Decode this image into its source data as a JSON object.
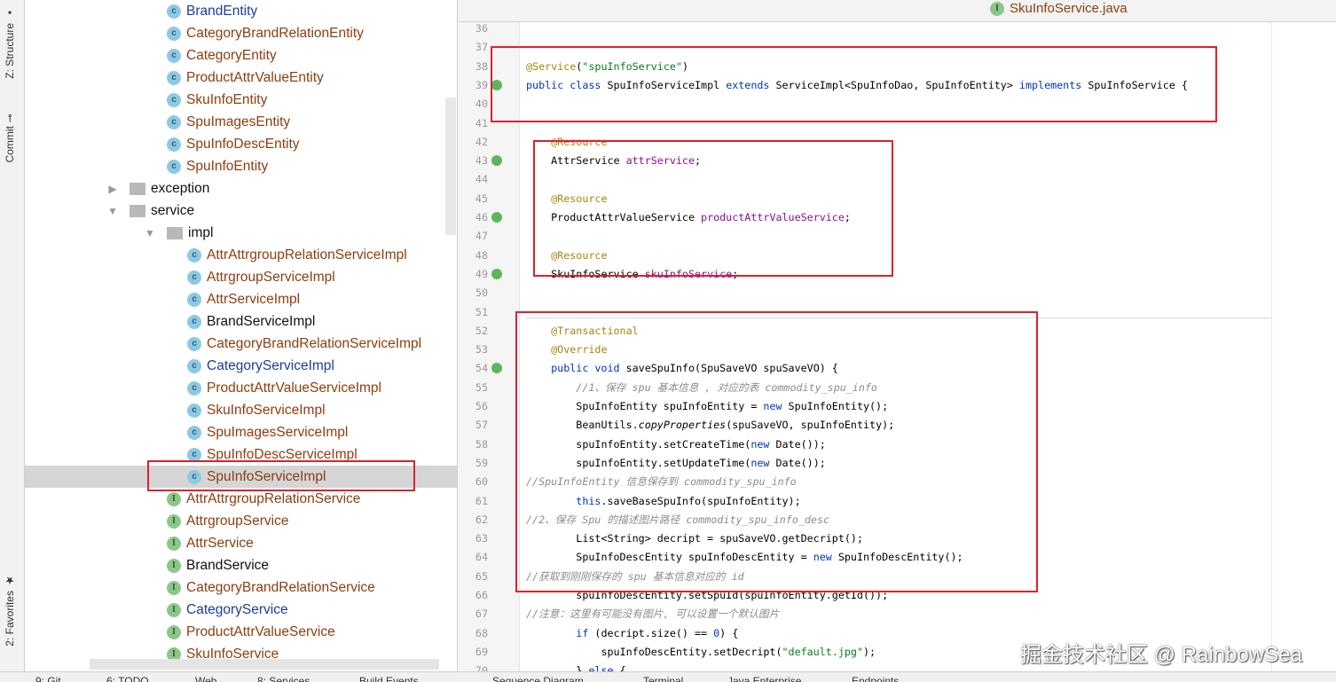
{
  "toolstrip": {
    "structure": "Z: Structure",
    "commit": "Commit",
    "favorites": "2: Favorites"
  },
  "tree": [
    {
      "label": "BrandEntity",
      "kind": "class",
      "color": "blue",
      "indent": 3
    },
    {
      "label": "CategoryBrandRelationEntity",
      "kind": "class",
      "color": "brown",
      "indent": 3
    },
    {
      "label": "CategoryEntity",
      "kind": "class",
      "color": "brown",
      "indent": 3
    },
    {
      "label": "ProductAttrValueEntity",
      "kind": "class",
      "color": "brown",
      "indent": 3
    },
    {
      "label": "SkuInfoEntity",
      "kind": "class",
      "color": "brown",
      "indent": 3
    },
    {
      "label": "SpuImagesEntity",
      "kind": "class",
      "color": "brown",
      "indent": 3
    },
    {
      "label": "SpuInfoDescEntity",
      "kind": "class",
      "color": "brown",
      "indent": 3
    },
    {
      "label": "SpuInfoEntity",
      "kind": "class",
      "color": "brown",
      "indent": 3
    },
    {
      "label": "exception",
      "kind": "folder",
      "expanded": false,
      "color": "black",
      "indent": 2
    },
    {
      "label": "service",
      "kind": "folder",
      "expanded": true,
      "color": "black",
      "indent": 2
    },
    {
      "label": "impl",
      "kind": "folder",
      "expanded": true,
      "color": "black",
      "indent": 3
    },
    {
      "label": "AttrAttrgroupRelationServiceImpl",
      "kind": "class",
      "color": "brown",
      "indent": 4
    },
    {
      "label": "AttrgroupServiceImpl",
      "kind": "class",
      "color": "brown",
      "indent": 4
    },
    {
      "label": "AttrServiceImpl",
      "kind": "class",
      "color": "brown",
      "indent": 4
    },
    {
      "label": "BrandServiceImpl",
      "kind": "class",
      "color": "black",
      "indent": 4
    },
    {
      "label": "CategoryBrandRelationServiceImpl",
      "kind": "class",
      "color": "brown",
      "indent": 4
    },
    {
      "label": "CategoryServiceImpl",
      "kind": "class",
      "color": "blue",
      "indent": 4
    },
    {
      "label": "ProductAttrValueServiceImpl",
      "kind": "class",
      "color": "brown",
      "indent": 4
    },
    {
      "label": "SkuInfoServiceImpl",
      "kind": "class",
      "color": "brown",
      "indent": 4
    },
    {
      "label": "SpuImagesServiceImpl",
      "kind": "class",
      "color": "brown",
      "indent": 4
    },
    {
      "label": "SpuInfoDescServiceImpl",
      "kind": "class",
      "color": "brown",
      "indent": 4
    },
    {
      "label": "SpuInfoServiceImpl",
      "kind": "class",
      "color": "brown",
      "indent": 4,
      "selected": true
    },
    {
      "label": "AttrAttrgroupRelationService",
      "kind": "interface",
      "color": "brown",
      "indent": 3
    },
    {
      "label": "AttrgroupService",
      "kind": "interface",
      "color": "brown",
      "indent": 3
    },
    {
      "label": "AttrService",
      "kind": "interface",
      "color": "brown",
      "indent": 3
    },
    {
      "label": "BrandService",
      "kind": "interface",
      "color": "black",
      "indent": 3
    },
    {
      "label": "CategoryBrandRelationService",
      "kind": "interface",
      "color": "brown",
      "indent": 3
    },
    {
      "label": "CategoryService",
      "kind": "interface",
      "color": "blue",
      "indent": 3
    },
    {
      "label": "ProductAttrValueService",
      "kind": "interface",
      "color": "brown",
      "indent": 3
    },
    {
      "label": "SkuInfoService",
      "kind": "interface",
      "color": "brown",
      "indent": 3
    }
  ],
  "editor": {
    "tab": "SkuInfoService.java",
    "lines": [
      {
        "n": "36",
        "s": []
      },
      {
        "n": "37",
        "s": []
      },
      {
        "n": "38",
        "s": [
          [
            "@Service",
            "a"
          ],
          [
            "(",
            ""
          ],
          [
            "\"spuInfoService\"",
            "s"
          ],
          [
            ")",
            ""
          ]
        ]
      },
      {
        "n": "39",
        "g": true,
        "s": [
          [
            "public class ",
            "k"
          ],
          [
            "SpuInfoServiceImpl ",
            ""
          ],
          [
            "extends ",
            "k"
          ],
          [
            "ServiceImpl<SpuInfoDao, SpuInfoEntity> ",
            ""
          ],
          [
            "implements ",
            "k"
          ],
          [
            "SpuInfoService {",
            ""
          ]
        ]
      },
      {
        "n": "40",
        "s": []
      },
      {
        "n": "41",
        "s": []
      },
      {
        "n": "42",
        "s": [
          [
            "    @Resource",
            "a"
          ]
        ]
      },
      {
        "n": "43",
        "g": true,
        "s": [
          [
            "    AttrService ",
            ""
          ],
          [
            "attrService",
            "f"
          ],
          [
            ";",
            ""
          ]
        ]
      },
      {
        "n": "44",
        "s": []
      },
      {
        "n": "45",
        "s": [
          [
            "    @Resource",
            "a"
          ]
        ]
      },
      {
        "n": "46",
        "g": true,
        "s": [
          [
            "    ProductAttrValueService ",
            ""
          ],
          [
            "productAttrValueService",
            "f"
          ],
          [
            ";",
            ""
          ]
        ]
      },
      {
        "n": "47",
        "s": []
      },
      {
        "n": "48",
        "s": [
          [
            "    @Resource",
            "a"
          ]
        ]
      },
      {
        "n": "49",
        "g": true,
        "s": [
          [
            "    SkuInfoService ",
            ""
          ],
          [
            "skuInfoService",
            "f"
          ],
          [
            ";",
            ""
          ]
        ]
      },
      {
        "n": "50",
        "s": []
      },
      {
        "n": "51",
        "s": []
      },
      {
        "n": "52",
        "s": [
          [
            "    @Transactional",
            "a"
          ]
        ]
      },
      {
        "n": "53",
        "s": [
          [
            "    @Override",
            "a"
          ]
        ]
      },
      {
        "n": "54",
        "g": true,
        "s": [
          [
            "    public void ",
            "k"
          ],
          [
            "saveSpuInfo(SpuSaveVO spuSaveVO) {",
            ""
          ]
        ]
      },
      {
        "n": "55",
        "s": [
          [
            "        //1、保存 spu 基本信息 , 对应的表 commodity_spu_info",
            "cm"
          ]
        ]
      },
      {
        "n": "56",
        "s": [
          [
            "        SpuInfoEntity spuInfoEntity = ",
            ""
          ],
          [
            "new ",
            "k"
          ],
          [
            "SpuInfoEntity();",
            ""
          ]
        ]
      },
      {
        "n": "57",
        "s": [
          [
            "        BeanUtils.",
            ""
          ],
          [
            "copyProperties",
            "it"
          ],
          [
            "(spuSaveVO, spuInfoEntity);",
            ""
          ]
        ]
      },
      {
        "n": "58",
        "s": [
          [
            "        spuInfoEntity.setCreateTime(",
            ""
          ],
          [
            "new ",
            "k"
          ],
          [
            "Date());",
            ""
          ]
        ]
      },
      {
        "n": "59",
        "s": [
          [
            "        spuInfoEntity.setUpdateTime(",
            ""
          ],
          [
            "new ",
            "k"
          ],
          [
            "Date());",
            ""
          ]
        ]
      },
      {
        "n": "60",
        "s": [
          [
            "//SpuInfoEntity 信息保存到 commodity_spu_info",
            "cm"
          ]
        ]
      },
      {
        "n": "61",
        "s": [
          [
            "        ",
            ""
          ],
          [
            "this",
            "k"
          ],
          [
            ".saveBaseSpuInfo(spuInfoEntity);",
            ""
          ]
        ]
      },
      {
        "n": "62",
        "s": [
          [
            "//2、保存 Spu 的描述图片路径 commodity_spu_info_desc",
            "cm"
          ]
        ]
      },
      {
        "n": "63",
        "s": [
          [
            "        List<String> decript = spuSaveVO.getDecript();",
            ""
          ]
        ]
      },
      {
        "n": "64",
        "s": [
          [
            "        SpuInfoDescEntity spuInfoDescEntity = ",
            ""
          ],
          [
            "new ",
            "k"
          ],
          [
            "SpuInfoDescEntity();",
            ""
          ]
        ]
      },
      {
        "n": "65",
        "s": [
          [
            "//获取到刚刚保存的 spu 基本信息对应的 id",
            "cm"
          ]
        ]
      },
      {
        "n": "66",
        "s": [
          [
            "        spuInfoDescEntity.setSpuId(spuInfoEntity.getId());",
            ""
          ]
        ]
      },
      {
        "n": "67",
        "s": [
          [
            "//注意：这里有可能没有图片, 可以设置一个默认图片",
            "cm"
          ]
        ]
      },
      {
        "n": "68",
        "s": [
          [
            "        ",
            ""
          ],
          [
            "if ",
            "k"
          ],
          [
            "(decript.size() == ",
            ""
          ],
          [
            "0",
            "k"
          ],
          [
            ") {",
            ""
          ]
        ]
      },
      {
        "n": "69",
        "s": [
          [
            "            spuInfoDescEntity.setDecript(",
            ""
          ],
          [
            "\"default.jpg\"",
            "s"
          ],
          [
            ");",
            ""
          ]
        ]
      },
      {
        "n": "70",
        "s": [
          [
            "        } ",
            ""
          ],
          [
            "else ",
            "k"
          ],
          [
            "{",
            ""
          ]
        ]
      }
    ]
  },
  "bottom_toolbar": [
    "9: Git",
    "6: TODO",
    "Web",
    "8: Services",
    "Build Events",
    "Sequence Diagram",
    "Terminal",
    "Java Enterprise",
    "Endpoints"
  ],
  "watermark": "掘金技术社区 @ RainbowSea",
  "colors": {
    "highlight_box": "#d9232e",
    "class_brown": "#8b3e10",
    "class_blue": "#1a3e9c"
  }
}
